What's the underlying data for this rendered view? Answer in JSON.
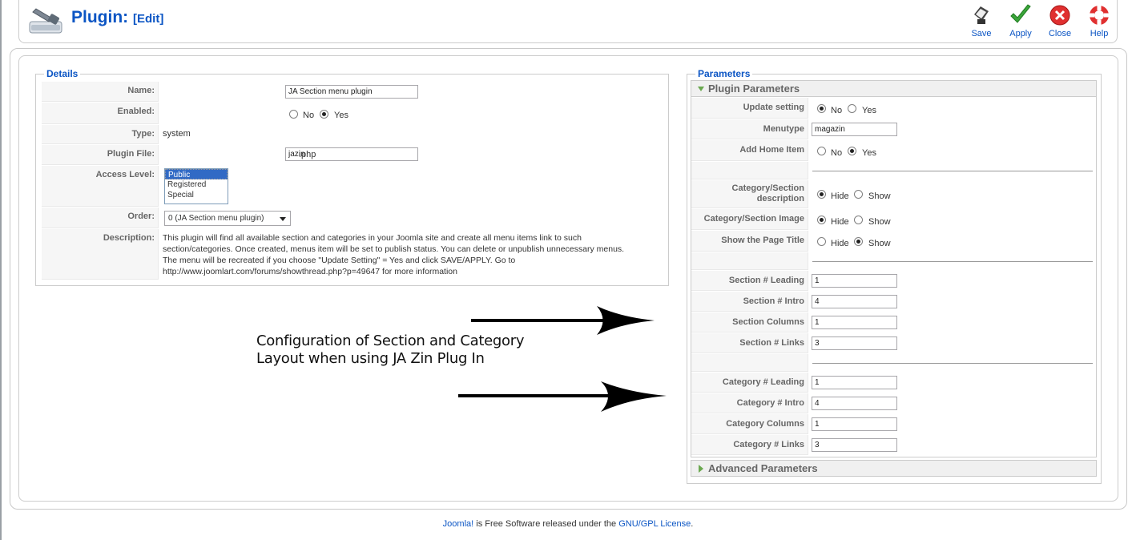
{
  "header": {
    "title": "Plugin:",
    "subtitle": "[Edit]",
    "toolbar": {
      "save": "Save",
      "apply": "Apply",
      "close": "Close",
      "help": "Help"
    }
  },
  "details": {
    "legend": "Details",
    "name_label": "Name:",
    "name_value": "JA Section menu plugin",
    "enabled_label": "Enabled:",
    "enabled_no": "No",
    "enabled_yes": "Yes",
    "type_label": "Type:",
    "type_value": "system",
    "file_label": "Plugin File:",
    "file_value": "jazin",
    "file_ext": ".php",
    "access_label": "Access Level:",
    "access_options": [
      "Public",
      "Registered",
      "Special"
    ],
    "order_label": "Order:",
    "order_value": "0 (JA Section menu plugin)",
    "description_label": "Description:",
    "description_lines": [
      "This plugin will find all available section and categories in your Joomla site and create all menu items link to such",
      "section/categories. Once created, menus item will be set to publish status. You can delete or unpublish unnecessary menus.",
      "The menu will be recreated if you choose \"Update Setting\" = Yes and click SAVE/APPLY. Go to",
      "http://www.joomlart.com/forums/showthread.php?p=49647 for more information"
    ]
  },
  "annotation": {
    "line1": "Configuration of Section and Category",
    "line2": "Layout when using JA Zin Plug In"
  },
  "parameters": {
    "legend": "Parameters",
    "plugin_panel": "Plugin Parameters",
    "advanced_panel": "Advanced Parameters",
    "update_setting_label": "Update setting",
    "no": "No",
    "yes": "Yes",
    "hide": "Hide",
    "show": "Show",
    "menutype_label": "Menutype",
    "menutype_value": "magazin",
    "add_home_label": "Add Home Item",
    "cat_desc_label_1": "Category/Section",
    "cat_desc_label_2": "description",
    "cat_image_label": "Category/Section Image",
    "page_title_label": "Show the Page Title",
    "section_leading_label": "Section # Leading",
    "section_leading_value": "1",
    "section_intro_label": "Section # Intro",
    "section_intro_value": "4",
    "section_columns_label": "Section Columns",
    "section_columns_value": "1",
    "section_links_label": "Section # Links",
    "section_links_value": "3",
    "category_leading_label": "Category # Leading",
    "category_leading_value": "1",
    "category_intro_label": "Category # Intro",
    "category_intro_value": "4",
    "category_columns_label": "Category Columns",
    "category_columns_value": "1",
    "category_links_label": "Category # Links",
    "category_links_value": "3"
  },
  "footer": {
    "joomla": "Joomla!",
    "middle": " is Free Software released under the ",
    "license": "GNU/GPL License",
    "end": "."
  }
}
